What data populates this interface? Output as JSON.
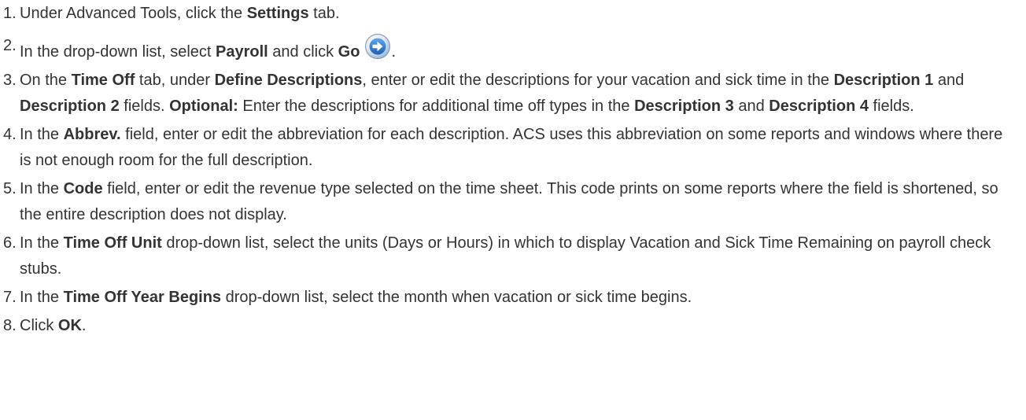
{
  "steps": [
    {
      "num": "1.",
      "parts": [
        "Under Advanced Tools, click the ",
        "Settings",
        " tab."
      ]
    },
    {
      "num": "2.",
      "parts": [
        "In the drop-down list, select ",
        "Payroll",
        " and click ",
        "Go",
        "."
      ],
      "icon": "go-arrow-icon"
    },
    {
      "num": "3.",
      "parts": [
        "On the ",
        "Time Off",
        " tab, under ",
        "Define Descriptions",
        ", enter or edit the descriptions for your vacation and sick time in the ",
        "Description 1",
        " and ",
        "Description 2",
        " fields. ",
        "Optional:",
        " Enter the descriptions for additional time off types in the ",
        "Description 3",
        " and ",
        "Description 4",
        " fields."
      ]
    },
    {
      "num": "4.",
      "parts": [
        "In the ",
        "Abbrev.",
        " field, enter or edit the abbreviation for each description. ACS uses this abbreviation on some reports and windows where there is not enough room for the full description."
      ]
    },
    {
      "num": "5.",
      "parts": [
        "In the ",
        "Code",
        " field, enter or edit the revenue type selected on the time sheet. This code prints on some reports where the field is shortened, so the entire description does not display."
      ]
    },
    {
      "num": "6.",
      "parts": [
        "In the ",
        "Time Off Unit",
        " drop-down list, select the units (Days or Hours) in which to display Vacation and Sick Time Remaining on payroll check stubs."
      ]
    },
    {
      "num": "7.",
      "parts": [
        "In the ",
        "Time Off Year Begins",
        " drop-down list, select the month when vacation or sick time begins."
      ]
    },
    {
      "num": "8.",
      "parts": [
        "Click ",
        "OK",
        "."
      ]
    }
  ],
  "colors": {
    "text": "#333333",
    "icon_blue": "#3a7fd0",
    "icon_light": "#cfe3f7"
  }
}
